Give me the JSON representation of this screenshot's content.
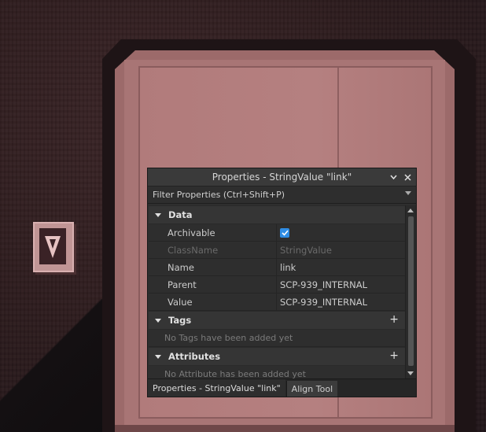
{
  "panel": {
    "title": "Properties - StringValue \"link\"",
    "filter_placeholder": "Filter Properties (Ctrl+Shift+P)",
    "sections": {
      "data": {
        "label": "Data",
        "rows": [
          {
            "name": "Archivable",
            "value": ""
          },
          {
            "name": "ClassName",
            "value": "StringValue"
          },
          {
            "name": "Name",
            "value": "link"
          },
          {
            "name": "Parent",
            "value": "SCP-939_INTERNAL"
          },
          {
            "name": "Value",
            "value": "SCP-939_INTERNAL"
          }
        ],
        "archivable_checked": true
      },
      "tags": {
        "label": "Tags",
        "empty": "No Tags have been added yet"
      },
      "attributes": {
        "label": "Attributes",
        "empty": "No Attribute has been added yet"
      }
    },
    "tabs": [
      {
        "label": "Properties - StringValue \"link\""
      },
      {
        "label": "Align Tool"
      }
    ],
    "accent": "#2f8de4"
  }
}
